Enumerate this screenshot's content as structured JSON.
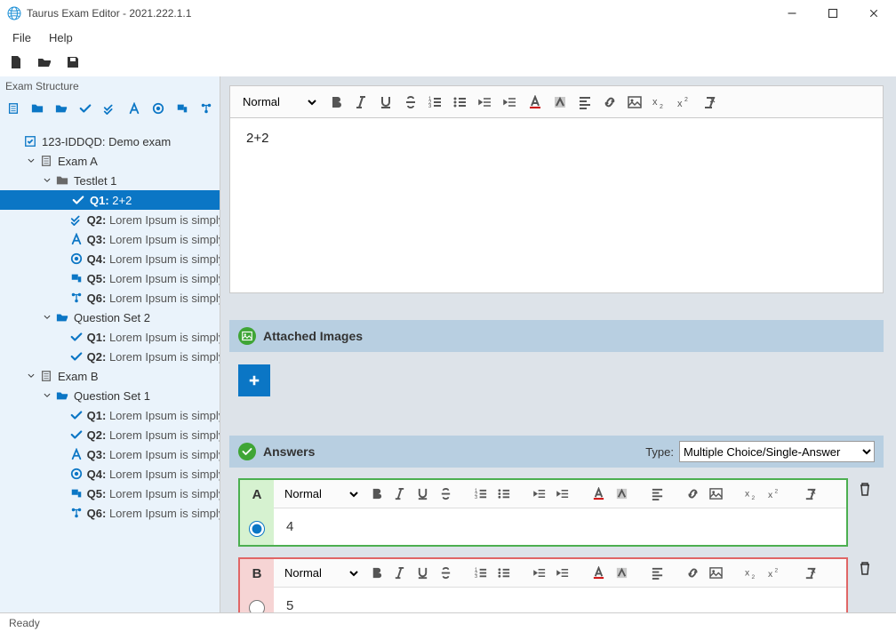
{
  "window": {
    "title": "Taurus Exam Editor - 2021.222.1.1"
  },
  "menus": {
    "file": "File",
    "help": "Help"
  },
  "sidebar": {
    "title": "Exam Structure",
    "root": {
      "label": "123-IDDQD: Demo exam"
    },
    "examA": {
      "label": "Exam A"
    },
    "testlet1": {
      "label": "Testlet 1"
    },
    "qA": [
      {
        "id": "Q1:",
        "text": " 2+2",
        "icon": "check",
        "selected": true
      },
      {
        "id": "Q2:",
        "text": " Lorem Ipsum is simply du",
        "icon": "check2"
      },
      {
        "id": "Q3:",
        "text": " Lorem Ipsum is simply du",
        "icon": "font"
      },
      {
        "id": "Q4:",
        "text": " Lorem Ipsum is simply du",
        "icon": "target"
      },
      {
        "id": "Q5:",
        "text": " Lorem Ipsum is simply du",
        "icon": "flag"
      },
      {
        "id": "Q6:",
        "text": " Lorem Ipsum is simply du",
        "icon": "flow"
      }
    ],
    "qset2": {
      "label": "Question Set 2"
    },
    "qB": [
      {
        "id": "Q1:",
        "text": " Lorem Ipsum is simply du",
        "icon": "check"
      },
      {
        "id": "Q2:",
        "text": " Lorem Ipsum is simply du",
        "icon": "check"
      }
    ],
    "examB": {
      "label": "Exam B"
    },
    "qset1B": {
      "label": "Question Set 1"
    },
    "qC": [
      {
        "id": "Q1:",
        "text": " Lorem Ipsum is simply du",
        "icon": "check"
      },
      {
        "id": "Q2:",
        "text": " Lorem Ipsum is simply du",
        "icon": "check"
      },
      {
        "id": "Q3:",
        "text": " Lorem Ipsum is simply du",
        "icon": "font"
      },
      {
        "id": "Q4:",
        "text": " Lorem Ipsum is simply du",
        "icon": "target"
      },
      {
        "id": "Q5:",
        "text": " Lorem Ipsum is simply du",
        "icon": "flag"
      },
      {
        "id": "Q6:",
        "text": " Lorem Ipsum is simply du",
        "icon": "flow"
      }
    ]
  },
  "editor": {
    "format": "Normal",
    "body": "2+2"
  },
  "sections": {
    "attached": "Attached Images",
    "answers": "Answers",
    "typeLabel": "Type:",
    "typeValue": "Multiple Choice/Single-Answer"
  },
  "answers": [
    {
      "letter": "A",
      "text": "4",
      "correct": true,
      "checked": true,
      "format": "Normal"
    },
    {
      "letter": "B",
      "text": "5",
      "correct": false,
      "checked": false,
      "format": "Normal"
    }
  ],
  "status": "Ready"
}
